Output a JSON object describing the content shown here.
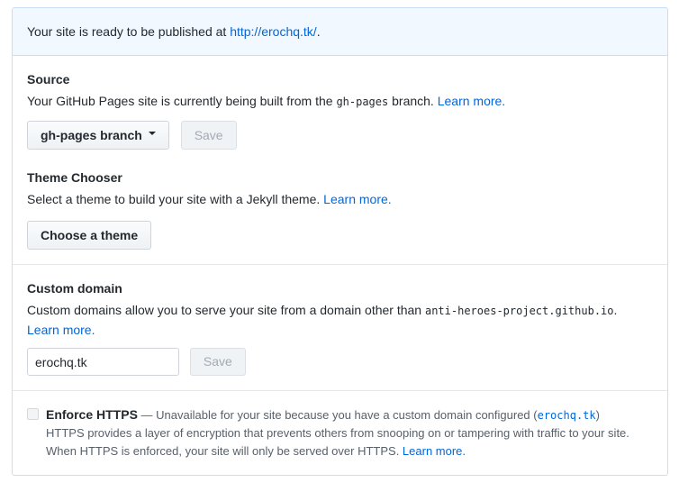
{
  "colors": {
    "accent_link": "#0366d6",
    "banner_bg": "#f1f8ff",
    "banner_border": "#c7def5",
    "text": "#24292e",
    "muted_text": "#586069",
    "box_border": "#d9dcdf"
  },
  "banner": {
    "prefix": "Your site is ready to be published at ",
    "url": "http://erochq.tk/",
    "suffix": "."
  },
  "source": {
    "heading": "Source",
    "desc_prefix": "Your GitHub Pages site is currently being built from the ",
    "branch_code": "gh-pages",
    "desc_suffix": " branch. ",
    "learn_more": "Learn more.",
    "branch_dropdown_label": "gh-pages branch",
    "save_label": "Save"
  },
  "theme_chooser": {
    "heading": "Theme Chooser",
    "desc": "Select a theme to build your site with a Jekyll theme. ",
    "learn_more": "Learn more.",
    "button_label": "Choose a theme"
  },
  "custom_domain": {
    "heading": "Custom domain",
    "desc_prefix": "Custom domains allow you to serve your site from a domain other than ",
    "domain_code": "anti-heroes-project.github.io",
    "desc_suffix": ". ",
    "learn_more": "Learn more.",
    "input_value": "erochq.tk",
    "save_label": "Save"
  },
  "enforce_https": {
    "label": "Enforce HTTPS",
    "note_prefix": " — Unavailable for your site because you have a custom domain configured (",
    "domain_link": "erochq.tk",
    "note_suffix": ")",
    "desc_line1": "HTTPS provides a layer of encryption that prevents others from snooping on or tampering with traffic to your site.",
    "desc_line2": "When HTTPS is enforced, your site will only be served over HTTPS. ",
    "learn_more": "Learn more."
  }
}
